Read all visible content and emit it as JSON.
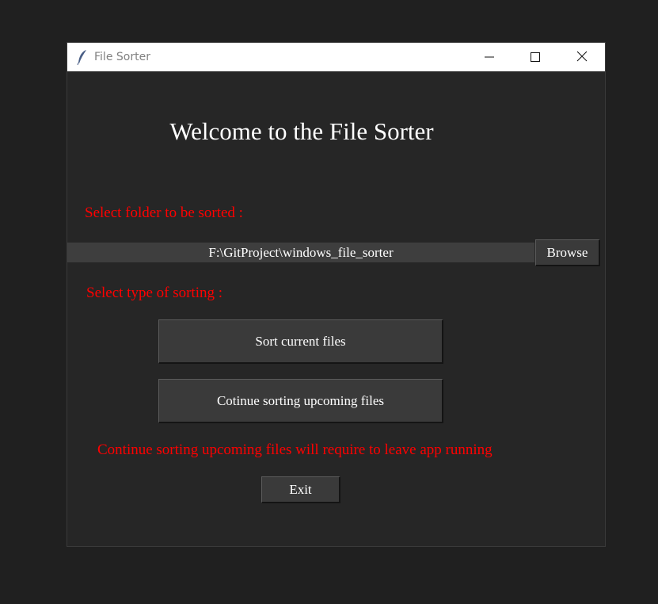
{
  "window": {
    "title": "File Sorter",
    "app_icon": "feather-icon",
    "controls": [
      "minimize-icon",
      "maximize-icon",
      "close-icon"
    ]
  },
  "main": {
    "welcome": "Welcome to the File Sorter",
    "folder_label": "Select folder to be sorted :",
    "folder_path": "F:\\GitProject\\windows_file_sorter",
    "browse_label": "Browse",
    "sort_type_label": "Select type of sorting :",
    "sort_current_label": "Sort current files",
    "continue_sorting_label": "Cotinue sorting upcoming files",
    "note": "Continue sorting upcoming files will require to leave app running",
    "exit_label": "Exit"
  },
  "colors": {
    "background": "#262626",
    "accent_text": "#ff0000",
    "button": "#3a3a3a",
    "path_field": "#3e3e3e"
  }
}
